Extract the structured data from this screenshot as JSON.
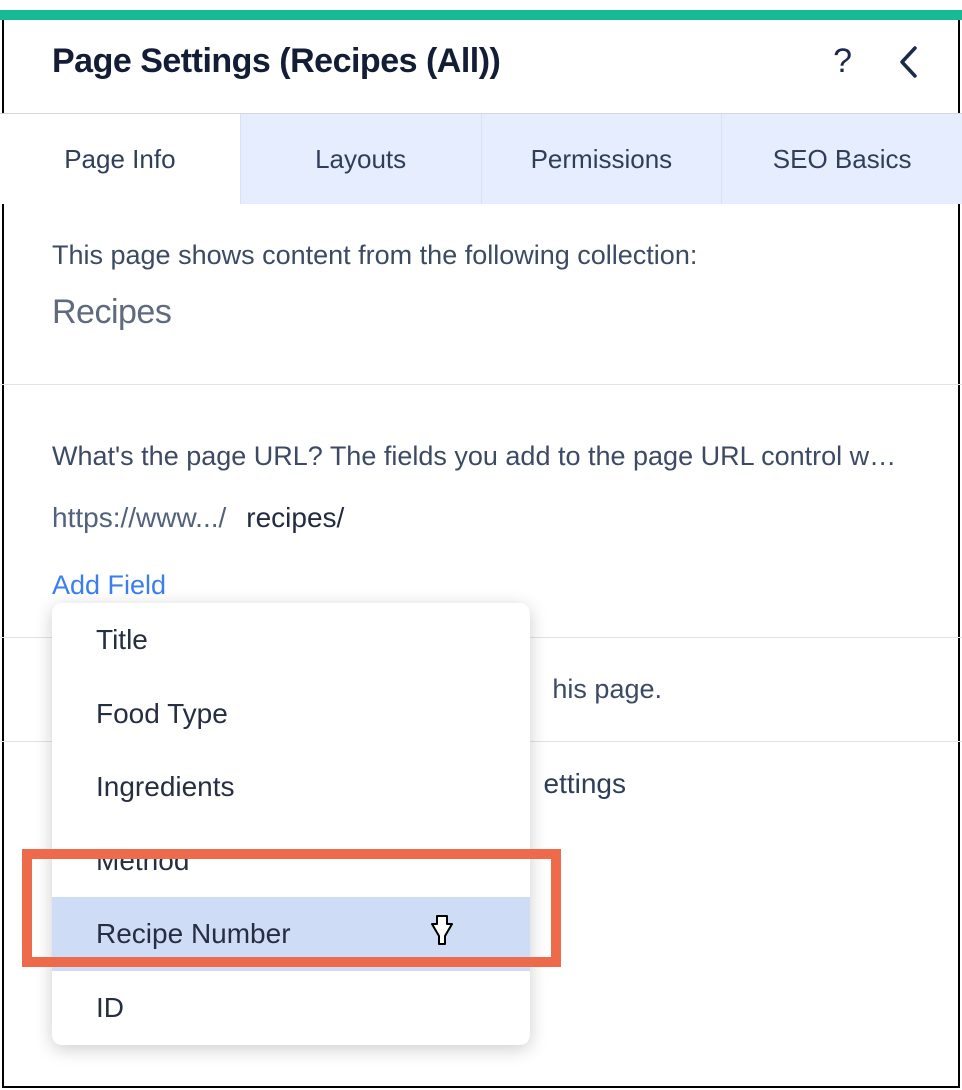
{
  "header": {
    "title": "Page Settings (Recipes (All))"
  },
  "tabs": [
    {
      "label": "Page Info",
      "active": true
    },
    {
      "label": "Layouts",
      "active": false
    },
    {
      "label": "Permissions",
      "active": false
    },
    {
      "label": "SEO Basics",
      "active": false
    }
  ],
  "collection_section": {
    "label": "This page shows content from the following collection:",
    "name": "Recipes"
  },
  "url_section": {
    "label": "What's the page URL? The fields you add to the page URL control wha…",
    "prefix": "https://www.../",
    "path": "recipes/",
    "add_field_label": "Add Field"
  },
  "page_text_fragment": "his page.",
  "settings_text_fragment": "ettings",
  "dropdown": {
    "items": [
      {
        "label": "Title",
        "hovered": false
      },
      {
        "label": "Food Type",
        "hovered": false
      },
      {
        "label": "Ingredients",
        "hovered": false
      },
      {
        "label": "Method",
        "hovered": false
      },
      {
        "label": "Recipe Number",
        "hovered": true
      },
      {
        "label": "ID",
        "hovered": false
      }
    ]
  }
}
